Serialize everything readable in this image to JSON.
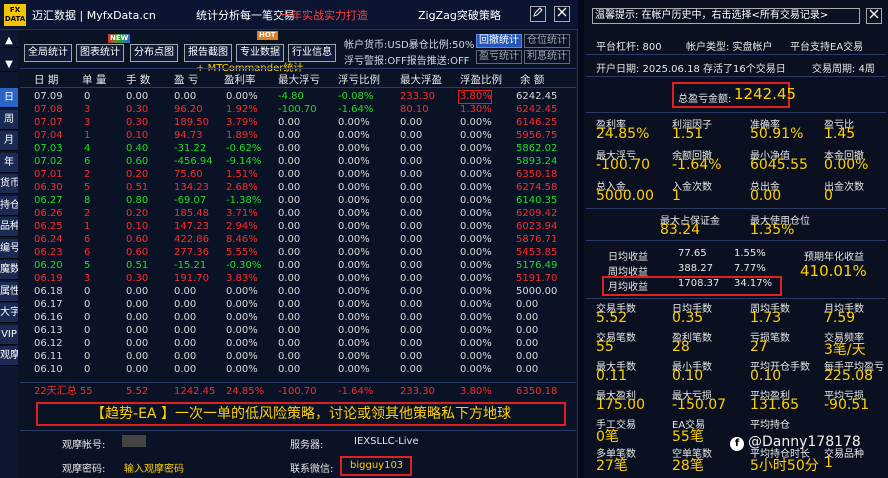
{
  "titlebar": {
    "logo_line1": "FX",
    "logo_line2": "DATA",
    "app_name": "迈汇数据 | MyfxData.cn",
    "slogan1": "统计分析每一笔交易",
    "slogan2": "十年实战实力打造",
    "ea_name": "ZigZag突破策略",
    "edit_icon": "pencil-icon",
    "close_icon": "close-icon"
  },
  "sidebar": {
    "scroll_up": "▲",
    "scroll_down": "▼",
    "items": [
      "日",
      "周",
      "月",
      "年",
      "货币",
      "持仓",
      "品种",
      "编号",
      "魔数",
      "属性",
      "大字",
      "VIP",
      "观摩"
    ]
  },
  "toolbar": {
    "buttons": [
      "全局统计",
      "图表统计",
      "分布点图",
      "报告截图",
      "专业数据",
      "行业信息"
    ],
    "new_badge": "NEW",
    "hot_badge": "HOT",
    "mt_label": "MTCommander统计"
  },
  "account_info": {
    "line1": "帐户货币:USD暴仓比例:50%",
    "line2": "浮亏警报:OFF报告推送:OFF",
    "buttons": [
      "回撤统计",
      "仓位统计",
      "盈亏统计",
      "利息统计"
    ]
  },
  "table": {
    "headers": [
      "日 期",
      "单 量",
      "手 数",
      "盈 亏",
      "盈利率",
      "最大浮亏",
      "浮亏比例",
      "最大浮盈",
      "浮盈比例",
      "余 额"
    ],
    "rows": [
      [
        "07.09",
        "0",
        "0.00",
        "0.00",
        "0.00%",
        "-4.80",
        "-0.08%",
        "233.30",
        "3.80%",
        "6242.45"
      ],
      [
        "07.08",
        "3",
        "0.30",
        "96.20",
        "1.92%",
        "-100.70",
        "-1.64%",
        "80.10",
        "1.30%",
        "6242.45"
      ],
      [
        "07.07",
        "3",
        "0.30",
        "189.50",
        "3.79%",
        "0.00",
        "0.00%",
        "0.00",
        "0.00%",
        "6146.25"
      ],
      [
        "07.04",
        "1",
        "0.10",
        "94.73",
        "1.89%",
        "0.00",
        "0.00%",
        "0.00",
        "0.00%",
        "5956.75"
      ],
      [
        "07.03",
        "4",
        "0.40",
        "-31.22",
        "-0.62%",
        "0.00",
        "0.00%",
        "0.00",
        "0.00%",
        "5862.02"
      ],
      [
        "07.02",
        "6",
        "0.60",
        "-456.94",
        "-9.14%",
        "0.00",
        "0.00%",
        "0.00",
        "0.00%",
        "5893.24"
      ],
      [
        "07.01",
        "2",
        "0.20",
        "75.60",
        "1.51%",
        "0.00",
        "0.00%",
        "0.00",
        "0.00%",
        "6350.18"
      ],
      [
        "06.30",
        "5",
        "0.51",
        "134.23",
        "2.68%",
        "0.00",
        "0.00%",
        "0.00",
        "0.00%",
        "6274.58"
      ],
      [
        "06.27",
        "8",
        "0.80",
        "-69.07",
        "-1.38%",
        "0.00",
        "0.00%",
        "0.00",
        "0.00%",
        "6140.35"
      ],
      [
        "06.26",
        "2",
        "0.20",
        "185.48",
        "3.71%",
        "0.00",
        "0.00%",
        "0.00",
        "0.00%",
        "6209.42"
      ],
      [
        "06.25",
        "1",
        "0.10",
        "147.23",
        "2.94%",
        "0.00",
        "0.00%",
        "0.00",
        "0.00%",
        "6023.94"
      ],
      [
        "06.24",
        "6",
        "0.60",
        "422.86",
        "8.46%",
        "0.00",
        "0.00%",
        "0.00",
        "0.00%",
        "5876.71"
      ],
      [
        "06.23",
        "6",
        "0.60",
        "277.36",
        "5.55%",
        "0.00",
        "0.00%",
        "0.00",
        "0.00%",
        "5453.85"
      ],
      [
        "06.20",
        "5",
        "0.51",
        "-15.21",
        "-0.30%",
        "0.00",
        "0.00%",
        "0.00",
        "0.00%",
        "5176.49"
      ],
      [
        "06.19",
        "3",
        "0.30",
        "191.70",
        "3.83%",
        "0.00",
        "0.00%",
        "0.00",
        "0.00%",
        "5191.70"
      ],
      [
        "06.18",
        "0",
        "0.00",
        "0.00",
        "0.00%",
        "0.00",
        "0.00%",
        "0.00",
        "0.00%",
        "5000.00"
      ],
      [
        "06.17",
        "0",
        "0.00",
        "0.00",
        "0.00%",
        "0.00",
        "0.00%",
        "0.00",
        "0.00%",
        "0.00"
      ],
      [
        "06.16",
        "0",
        "0.00",
        "0.00",
        "0.00%",
        "0.00",
        "0.00%",
        "0.00",
        "0.00%",
        "0.00"
      ],
      [
        "06.13",
        "0",
        "0.00",
        "0.00",
        "0.00%",
        "0.00",
        "0.00%",
        "0.00",
        "0.00%",
        "0.00"
      ],
      [
        "06.12",
        "0",
        "0.00",
        "0.00",
        "0.00%",
        "0.00",
        "0.00%",
        "0.00",
        "0.00%",
        "0.00"
      ],
      [
        "06.11",
        "0",
        "0.00",
        "0.00",
        "0.00%",
        "0.00",
        "0.00%",
        "0.00",
        "0.00%",
        "0.00"
      ],
      [
        "06.10",
        "0",
        "0.00",
        "0.00",
        "0.00%",
        "0.00",
        "0.00%",
        "0.00",
        "0.00%",
        "0.00"
      ]
    ],
    "summary": [
      "22天汇总 55",
      "5.52",
      "1242.45",
      "24.85%",
      "-100.70",
      "-1.64%",
      "233.30",
      "3.80%",
      "6350.18"
    ]
  },
  "banner": {
    "text": "【趋势-EA 】一次一单的低风险策略，讨论或领其他策略私下方地球"
  },
  "observer": {
    "account_label": "观摩帐号:",
    "password_label": "观摩密码:",
    "password_value": "输入观摩密码",
    "server_label": "服务器:",
    "server_value": "IEXSLLC-Live",
    "wechat_label": "联系微信:",
    "wechat_value": "bigguy103"
  },
  "right_panel": {
    "tip": "温馨提示: 在帐户历史中，右击选择<所有交易记录>",
    "close_icon": "close-icon",
    "platform": "平台杠杆: 800",
    "account_type": "帐户类型: 实盘帐户",
    "ea_support": "平台支持EA交易",
    "open_date": "开户日期: 2025.06.18 存活了16个交易日",
    "trade_cycle": "交易周期: 4周",
    "total_profit_label": "总盈亏金额:",
    "total_profit_value": "1242.45",
    "stats": [
      {
        "label": "盈利率",
        "value": "24.85%"
      },
      {
        "label": "利润因子",
        "value": "1.51"
      },
      {
        "label": "准确率",
        "value": "50.91%"
      },
      {
        "label": "盈亏比",
        "value": "1.45"
      },
      {
        "label": "最大浮亏",
        "value": "-100.70"
      },
      {
        "label": "余额回撤",
        "value": "-1.64%"
      },
      {
        "label": "最小净值",
        "value": "6045.55"
      },
      {
        "label": "本金回撤",
        "value": "0.00%"
      },
      {
        "label": "总入金",
        "value": "5000.00"
      },
      {
        "label": "入金次数",
        "value": "1"
      },
      {
        "label": "总出金",
        "value": "0.00"
      },
      {
        "label": "出金次数",
        "value": "0"
      }
    ],
    "margin": [
      {
        "label": "最大占保证金",
        "value": "83.24"
      },
      {
        "label": "最大使用仓位",
        "value": "1.35%"
      }
    ],
    "period_rows": [
      {
        "label": "日均收益",
        "amount": "77.65",
        "pct": "1.55%"
      },
      {
        "label": "周均收益",
        "amount": "388.27",
        "pct": "7.77%"
      },
      {
        "label": "月均收益",
        "amount": "1708.37",
        "pct": "34.17%"
      }
    ],
    "annual_label": "预期年化收益",
    "annual_value": "410.01%",
    "stats2": [
      {
        "label": "交易手数",
        "value": "5.52"
      },
      {
        "label": "日均手数",
        "value": "0.35"
      },
      {
        "label": "周均手数",
        "value": "1.73"
      },
      {
        "label": "月均手数",
        "value": "7.59"
      },
      {
        "label": "交易笔数",
        "value": "55"
      },
      {
        "label": "盈利笔数",
        "value": "28"
      },
      {
        "label": "亏损笔数",
        "value": "27"
      },
      {
        "label": "交易频率",
        "value": "3笔/天"
      },
      {
        "label": "最大手数",
        "value": "0.11"
      },
      {
        "label": "最小手数",
        "value": "0.10"
      },
      {
        "label": "平均开仓手数",
        "value": "0.10"
      },
      {
        "label": "每手平均盈亏",
        "value": "225.08"
      },
      {
        "label": "最大盈利",
        "value": "175.00"
      },
      {
        "label": "最大亏损",
        "value": "-150.07"
      },
      {
        "label": "平均盈利",
        "value": "131.65"
      },
      {
        "label": "平均亏损",
        "value": "-90.51"
      },
      {
        "label": "手工交易",
        "value": "0笔"
      },
      {
        "label": "EA交易",
        "value": "55笔"
      },
      {
        "label": "平均持仓",
        "value": ""
      },
      {
        "label": "",
        "value": ""
      },
      {
        "label": "多单笔数",
        "value": "27笔"
      },
      {
        "label": "空单笔数",
        "value": "28笔"
      },
      {
        "label": "平均持仓时长",
        "value": "5小时50分"
      },
      {
        "label": "交易品种",
        "value": "1"
      }
    ]
  },
  "watermark": "@Danny178178",
  "colors": {
    "accent": "#ffd000",
    "profit": "#22dd22",
    "loss": "#ff2a2a",
    "highlight_box": "#e02020"
  }
}
